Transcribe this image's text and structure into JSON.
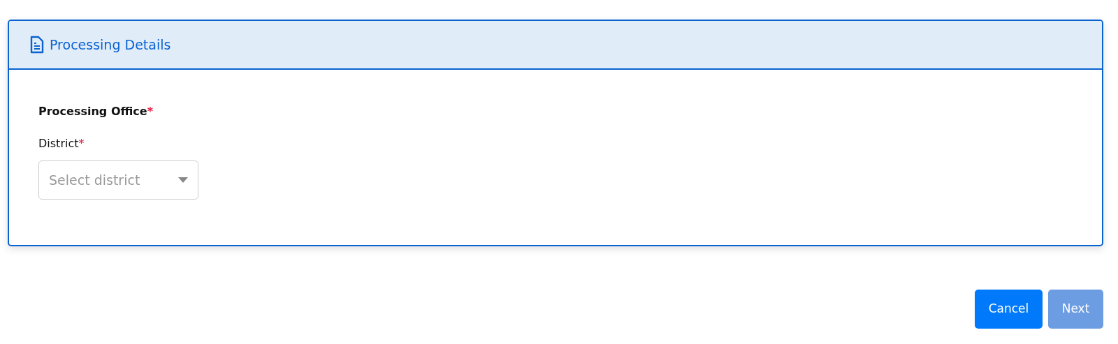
{
  "panel": {
    "title": "Processing Details"
  },
  "section": {
    "heading": "Processing Office",
    "required_mark": "*"
  },
  "fields": [
    {
      "label": "District",
      "required_mark": "*",
      "placeholder": "Select district"
    }
  ],
  "buttons": [
    {
      "label": "Cancel",
      "disabled": false
    },
    {
      "label": "Next",
      "disabled": true
    }
  ]
}
